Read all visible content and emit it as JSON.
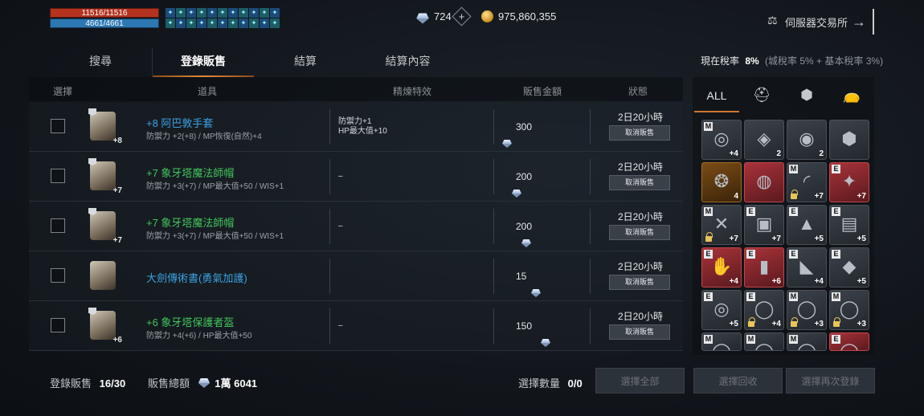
{
  "status": {
    "hp": "11516/11516",
    "mp": "4661/4661",
    "buff_icons": [
      "buff",
      "buff",
      "buff",
      "buff",
      "buff",
      "buff",
      "buff",
      "buff",
      "buff",
      "buff",
      "buff",
      "buff",
      "buff",
      "buff",
      "buff",
      "buff",
      "buff",
      "buff",
      "buff",
      "buff",
      "buff",
      "buff"
    ]
  },
  "currency": {
    "diamonds": "724",
    "adena": "975,860,355"
  },
  "exchange": {
    "label": "伺服器交易所"
  },
  "tabs": [
    "搜尋",
    "登錄販售",
    "結算",
    "結算內容"
  ],
  "tax": {
    "label": "現在稅率",
    "rate": "8%",
    "detail": "(城稅率 5% + 基本稅率 3%)"
  },
  "table": {
    "headers": {
      "select": "選擇",
      "item": "道具",
      "effect": "精煉特效",
      "price": "販售金額",
      "status": "狀態"
    },
    "rows": [
      {
        "name": "+8 阿巴敦手套",
        "stats": "防禦力 +2(+8) / MP恢復(自然)+4",
        "effect1": "防禦力+1",
        "effect2": "HP最大值+10",
        "price": "300",
        "time": "2日20小時",
        "cancel": "取消販售",
        "level": "+8",
        "color": "blue",
        "icon": "gauntlet-icon"
      },
      {
        "name": "+7 象牙塔魔法師帽",
        "stats": "防禦力 +3(+7) / MP最大值+50 / WIS+1",
        "effect1": "–",
        "effect2": "",
        "price": "200",
        "time": "2日20小時",
        "cancel": "取消販售",
        "level": "+7",
        "color": "green",
        "icon": "helmet-icon"
      },
      {
        "name": "+7 象牙塔魔法師帽",
        "stats": "防禦力 +3(+7) / MP最大值+50 / WIS+1",
        "effect1": "–",
        "effect2": "",
        "price": "200",
        "time": "2日20小時",
        "cancel": "取消販售",
        "level": "+7",
        "color": "green",
        "icon": "helmet-icon"
      },
      {
        "name": "大劍傳術書(勇氣加護)",
        "stats": "",
        "effect1": "",
        "effect2": "",
        "price": "15",
        "time": "2日20小時",
        "cancel": "取消販售",
        "level": "",
        "color": "blue",
        "icon": "book-icon"
      },
      {
        "name": "+6 象牙塔保護者盔",
        "stats": "防禦力 +4(+6) / HP最大值+50",
        "effect1": "–",
        "effect2": "",
        "price": "150",
        "time": "2日20小時",
        "cancel": "取消販售",
        "level": "+6",
        "color": "green",
        "icon": "helm-icon"
      }
    ]
  },
  "footer": {
    "registered_label": "登錄販售",
    "registered_value": "16/30",
    "total_label": "販售總額",
    "total_value": "1萬 6041",
    "selected_label": "選擇數量",
    "selected_value": "0/0",
    "btn_select_all": "選擇全部",
    "btn_recall": "選擇回收",
    "btn_relist": "選擇再次登錄"
  },
  "inventory": {
    "filter_all": "ALL",
    "slots": [
      {
        "style": "",
        "tag": "M",
        "count": "+4",
        "glyph": "◎",
        "lock": false
      },
      {
        "style": "",
        "tag": "",
        "count": "2",
        "glyph": "◈",
        "lock": false
      },
      {
        "style": "",
        "tag": "",
        "count": "2",
        "glyph": "◉",
        "lock": false
      },
      {
        "style": "",
        "tag": "",
        "count": "",
        "glyph": "⬢",
        "lock": false
      },
      {
        "style": "gold",
        "tag": "",
        "count": "4",
        "glyph": "❂",
        "lock": false
      },
      {
        "style": "red",
        "tag": "",
        "count": "",
        "glyph": "◍",
        "lock": false
      },
      {
        "style": "",
        "tag": "M",
        "count": "+7",
        "glyph": "◜",
        "lock": true
      },
      {
        "style": "red",
        "tag": "E",
        "count": "+7",
        "glyph": "✦",
        "lock": false
      },
      {
        "style": "",
        "tag": "M",
        "count": "+7",
        "glyph": "✕",
        "lock": true
      },
      {
        "style": "",
        "tag": "E",
        "count": "+7",
        "glyph": "▣",
        "lock": false
      },
      {
        "style": "",
        "tag": "E",
        "count": "+5",
        "glyph": "▲",
        "lock": false
      },
      {
        "style": "",
        "tag": "E",
        "count": "+5",
        "glyph": "▤",
        "lock": false
      },
      {
        "style": "red",
        "tag": "E",
        "count": "+4",
        "glyph": "✋",
        "lock": false
      },
      {
        "style": "red",
        "tag": "E",
        "count": "+6",
        "glyph": "▮",
        "lock": false
      },
      {
        "style": "",
        "tag": "E",
        "count": "+4",
        "glyph": "◣",
        "lock": false
      },
      {
        "style": "",
        "tag": "E",
        "count": "+5",
        "glyph": "◆",
        "lock": false
      },
      {
        "style": "",
        "tag": "E",
        "count": "+5",
        "glyph": "◎",
        "lock": false
      },
      {
        "style": "",
        "tag": "E",
        "count": "+4",
        "glyph": "◯",
        "lock": true
      },
      {
        "style": "",
        "tag": "M",
        "count": "+3",
        "glyph": "◯",
        "lock": true
      },
      {
        "style": "",
        "tag": "M",
        "count": "+3",
        "glyph": "◯",
        "lock": true
      },
      {
        "style": "",
        "tag": "M",
        "count": "",
        "glyph": "◯",
        "lock": false
      },
      {
        "style": "",
        "tag": "M",
        "count": "",
        "glyph": "◯",
        "lock": false
      },
      {
        "style": "",
        "tag": "M",
        "count": "",
        "glyph": "◯",
        "lock": false
      },
      {
        "style": "red",
        "tag": "E",
        "count": "",
        "glyph": "◯",
        "lock": false
      }
    ]
  }
}
